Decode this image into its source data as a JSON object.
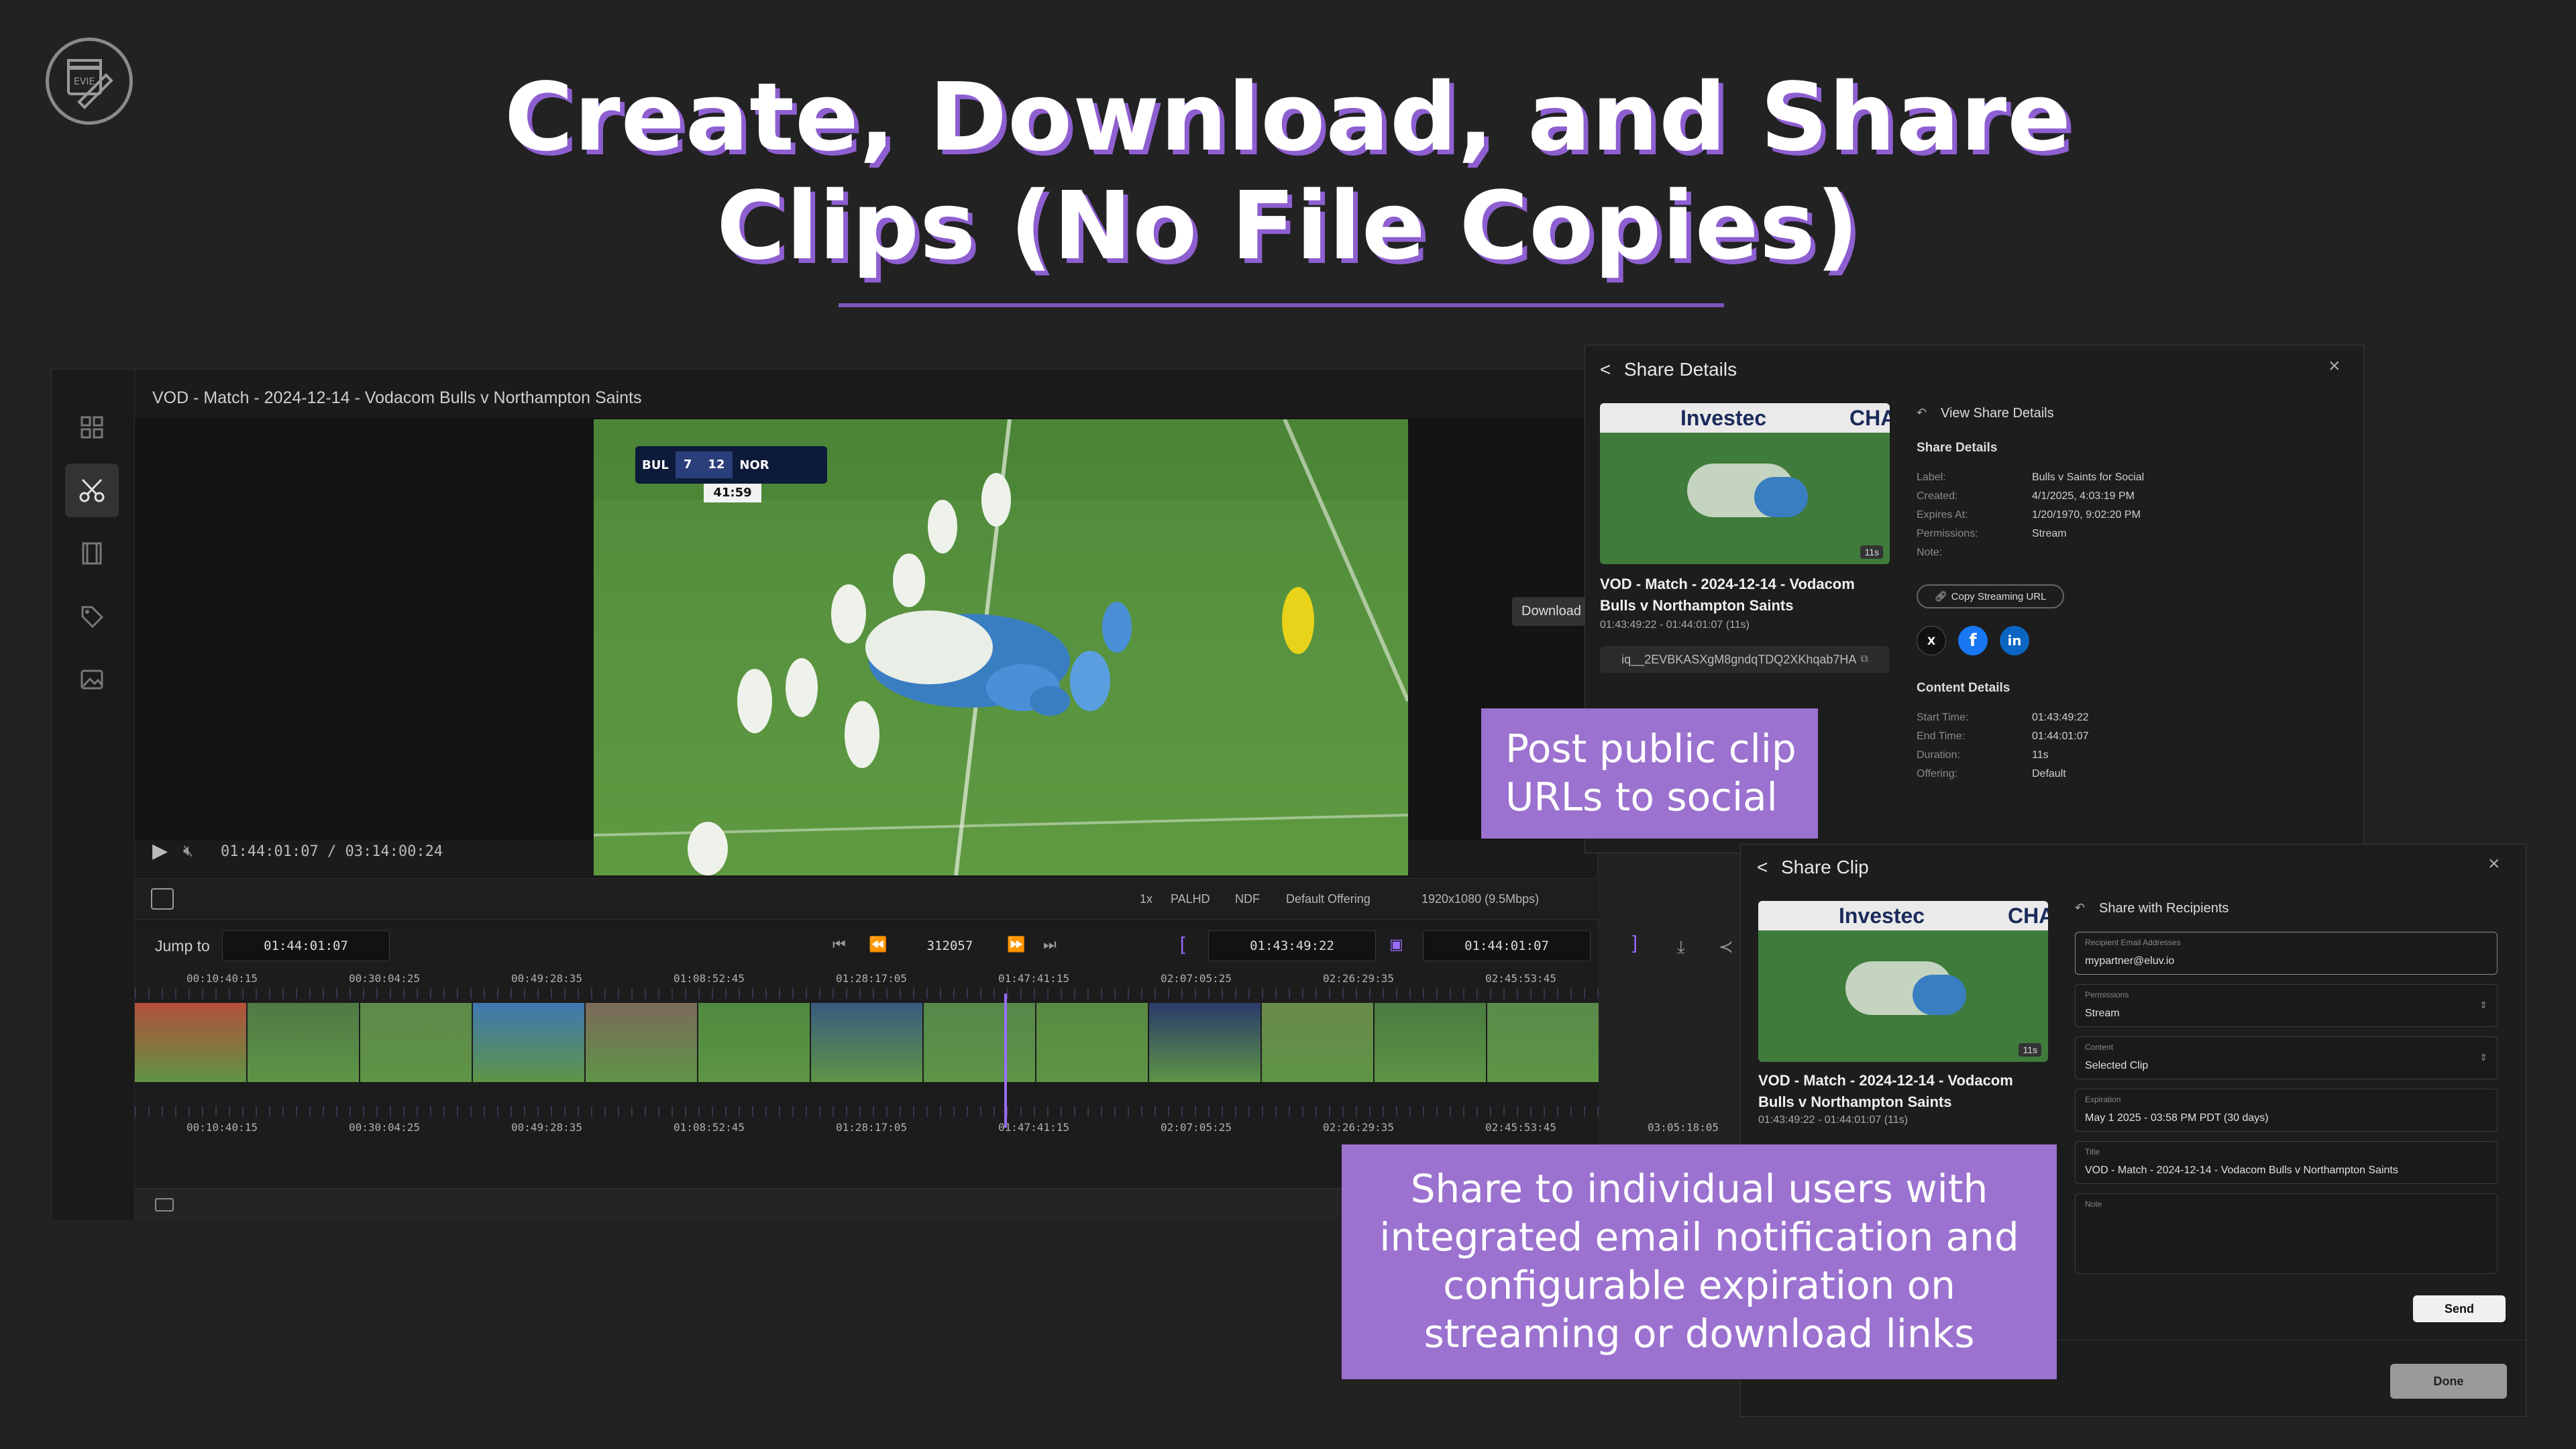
{
  "logo": {
    "text": "EVIE"
  },
  "heading": {
    "line1": "Create, Download, and Share",
    "line2": "Clips (No File Copies)"
  },
  "editor": {
    "video_title": "VOD - Match - 2024-12-14 - Vodacom Bulls v Northampton Saints",
    "rail_icons": [
      "grid-icon",
      "scissors-icon",
      "film-icon",
      "tag-icon",
      "image-icon"
    ],
    "scorebug": {
      "home": "BUL",
      "home_score": "7",
      "away_score": "12",
      "away": "NOR",
      "clock": "41:59"
    },
    "player": {
      "current_time": "01:44:01:07",
      "separator": "/",
      "duration": "03:14:00:24"
    },
    "info": {
      "speed": "1x",
      "format": "PALHD",
      "timecode_mode": "NDF",
      "offering": "Default Offering",
      "resolution": "1920x1080 (9.5Mbps)"
    },
    "timeline": {
      "jump_to_label": "Jump to",
      "jump_to_value": "01:44:01:07",
      "frame": "312057",
      "in_point": "01:43:49:22",
      "out_point": "01:44:01:07",
      "in_bracket": "[",
      "out_bracket": "]",
      "ticks_top": [
        "00:10:40:15",
        "00:30:04:25",
        "00:49:28:35",
        "01:08:52:45",
        "01:28:17:05",
        "01:47:41:15",
        "02:07:05:25",
        "02:26:29:35",
        "02:45:53:45"
      ],
      "ticks_bottom": [
        "00:10:40:15",
        "00:30:04:25",
        "00:49:28:35",
        "01:08:52:45",
        "01:28:17:05",
        "01:47:41:15",
        "02:07:05:25",
        "02:26:29:35",
        "02:45:53:45",
        "03:05:18:05"
      ],
      "download_tooltip": "Download Current Clip"
    }
  },
  "share_details": {
    "title": "Share Details",
    "close": "×",
    "thumb_sponsor": "Investec",
    "thumb_sponsor2": "CHA",
    "thumb_duration": "11s",
    "clip_title": "VOD - Match - 2024-12-14 - Vodacom Bulls v Northampton Saints",
    "clip_range": "01:43:49:22 - 01:44:01:07 (11s)",
    "clip_id": "iq__2EVBKASXgM8gndqTDQ2XKhqab7HA",
    "view_link": "View Share Details",
    "share_details_heading": "Share Details",
    "share_details_rows": [
      {
        "k": "Label:",
        "v": "Bulls v Saints for Social"
      },
      {
        "k": "Created:",
        "v": "4/1/2025, 4:03:19 PM"
      },
      {
        "k": "Expires At:",
        "v": "1/20/1970, 9:02:20 PM"
      },
      {
        "k": "Permissions:",
        "v": "Stream"
      },
      {
        "k": "Note:",
        "v": ""
      }
    ],
    "copy_url_label": "Copy Streaming URL",
    "socials": [
      "X",
      "f",
      "in"
    ],
    "content_heading": "Content Details",
    "content_rows": [
      {
        "k": "Start Time:",
        "v": "01:43:49:22"
      },
      {
        "k": "End Time:",
        "v": "01:44:01:07"
      },
      {
        "k": "Duration:",
        "v": "11s"
      },
      {
        "k": "Offering:",
        "v": "Default"
      }
    ]
  },
  "share_clip": {
    "title": "Share Clip",
    "close": "×",
    "thumb_sponsor": "Investec",
    "thumb_sponsor2": "CHA",
    "thumb_duration": "11s",
    "clip_title": "VOD - Match - 2024-12-14 - Vodacom Bulls v Northampton Saints",
    "clip_range": "01:43:49:22 - 01:44:01:07 (11s)",
    "recipients_heading": "Share with Recipients",
    "fields": {
      "email_label": "Recipient Email Addresses",
      "email_value": "mypartner@eluv.io",
      "permissions_label": "Permissions",
      "permissions_value": "Stream",
      "content_label": "Content",
      "content_value": "Selected Clip",
      "expiration_label": "Expiration",
      "expiration_value": "May 1 2025 - 03:58 PM PDT (30 days)",
      "title_label": "Title",
      "title_value": "VOD - Match - 2024-12-14 - Vodacom Bulls v Northampton Saints",
      "note_label": "Note"
    },
    "send_label": "Send",
    "done_label": "Done"
  },
  "callouts": {
    "social_line1": "Post public clip",
    "social_line2": "URLs to social",
    "share_lines": [
      "Share to individual users with",
      "integrated email notification and",
      "configurable expiration on",
      "streaming or download links"
    ]
  },
  "colors": {
    "accent": "#9b72cf",
    "background": "#222222",
    "heading_shadow": "#8e5fd0"
  }
}
